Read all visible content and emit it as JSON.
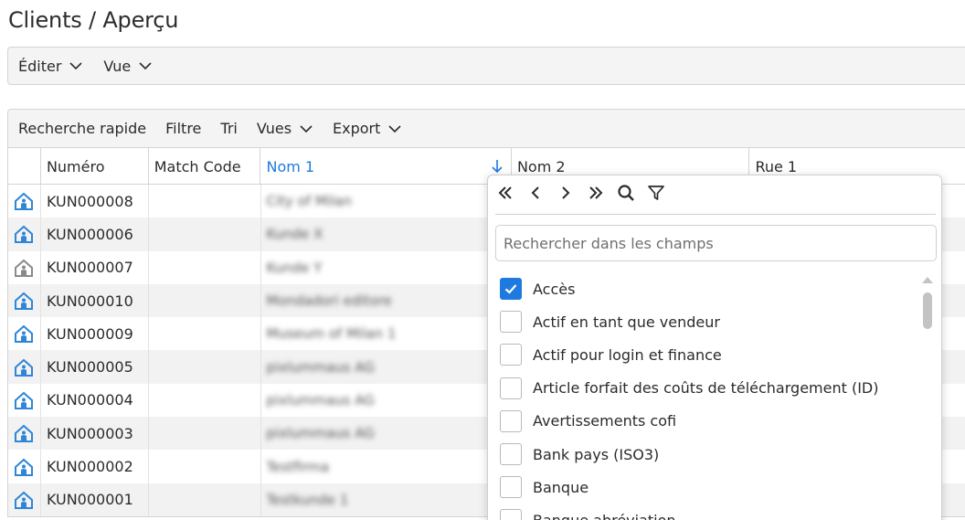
{
  "page": {
    "title": "Clients / Aperçu"
  },
  "menubar": {
    "items": [
      {
        "label": "Éditer"
      },
      {
        "label": "Vue"
      }
    ]
  },
  "toolbar": {
    "items": [
      {
        "label": "Recherche rapide",
        "dropdown": false
      },
      {
        "label": "Filtre",
        "dropdown": false
      },
      {
        "label": "Tri",
        "dropdown": false
      },
      {
        "label": "Vues",
        "dropdown": true
      },
      {
        "label": "Export",
        "dropdown": true
      }
    ]
  },
  "grid": {
    "columns": [
      "",
      "Numéro",
      "Match Code",
      "Nom 1",
      "Nom 2",
      "Rue 1"
    ],
    "sorted_column": "Nom 1",
    "sort_direction": "descending",
    "rows": [
      {
        "icon": "house-icon-blue",
        "numero": "KUN000008",
        "match_code": "",
        "nom1": "City of Milan"
      },
      {
        "icon": "house-icon-blue",
        "numero": "KUN000006",
        "match_code": "",
        "nom1": "Kunde X"
      },
      {
        "icon": "house-icon-grey",
        "numero": "KUN000007",
        "match_code": "",
        "nom1": "Kunde Y"
      },
      {
        "icon": "house-icon-blue",
        "numero": "KUN000010",
        "match_code": "",
        "nom1": "Mondadori editore"
      },
      {
        "icon": "house-icon-blue",
        "numero": "KUN000009",
        "match_code": "",
        "nom1": "Museum of Milan 1"
      },
      {
        "icon": "house-icon-blue",
        "numero": "KUN000005",
        "match_code": "",
        "nom1": "pixlummaus AG"
      },
      {
        "icon": "house-icon-blue",
        "numero": "KUN000004",
        "match_code": "",
        "nom1": "pixlummaus AG"
      },
      {
        "icon": "house-icon-blue",
        "numero": "KUN000003",
        "match_code": "",
        "nom1": "pixlummaus AG"
      },
      {
        "icon": "house-icon-blue",
        "numero": "KUN000002",
        "match_code": "",
        "nom1": "Testfirma"
      },
      {
        "icon": "house-icon-blue",
        "numero": "KUN000001",
        "match_code": "",
        "nom1": "Testkunde 1"
      }
    ]
  },
  "dropdown": {
    "search_placeholder": "Rechercher dans les champs",
    "tools": [
      "first-page-icon",
      "prev-icon",
      "next-icon",
      "last-page-icon",
      "search-icon",
      "filter-icon"
    ],
    "fields": [
      {
        "label": "Accès",
        "checked": true
      },
      {
        "label": "Actif en tant que vendeur",
        "checked": false
      },
      {
        "label": "Actif pour login et finance",
        "checked": false
      },
      {
        "label": "Article forfait des coûts de téléchargement (ID)",
        "checked": false
      },
      {
        "label": "Avertissements cofi",
        "checked": false
      },
      {
        "label": "Bank pays (ISO3)",
        "checked": false
      },
      {
        "label": "Banque",
        "checked": false
      },
      {
        "label": "Banque abréviation",
        "checked": false
      }
    ]
  },
  "colors": {
    "accent": "#1f7ae0",
    "house_blue": "#2f86d6",
    "house_grey": "#8a8a8a",
    "row_alt": "#f2f2f2"
  }
}
